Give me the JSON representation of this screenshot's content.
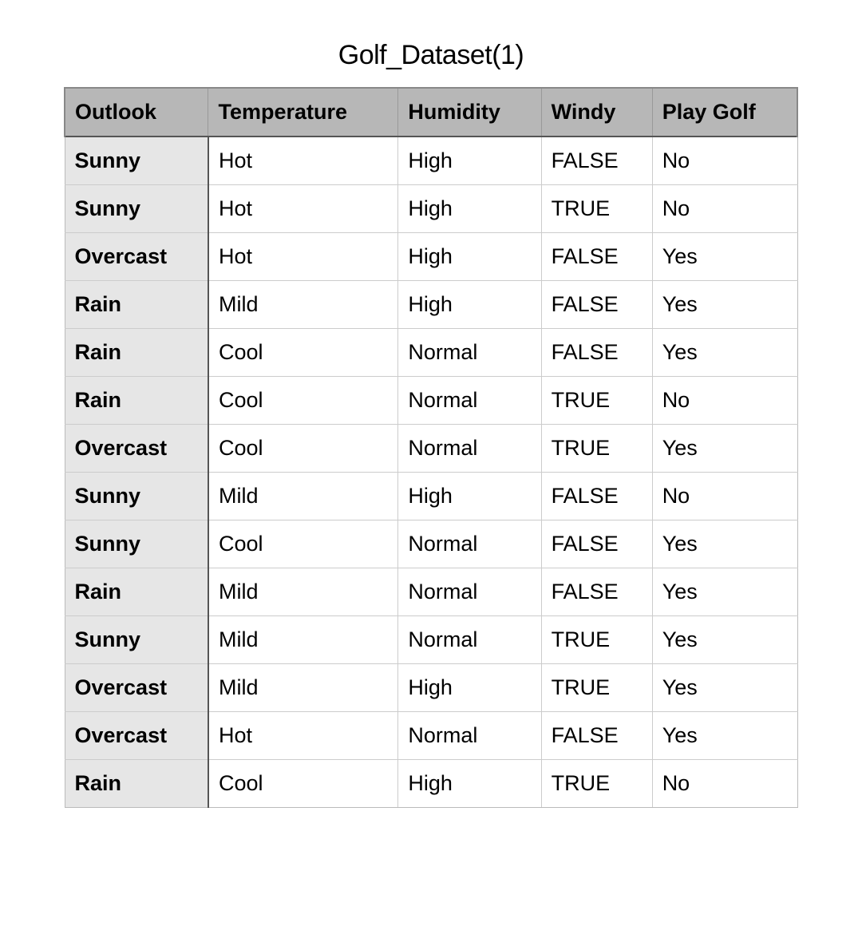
{
  "title": "Golf_Dataset(1)",
  "columns": [
    "Outlook",
    "Temperature",
    "Humidity",
    "Windy",
    "Play Golf"
  ],
  "rows": [
    {
      "outlook": "Sunny",
      "temperature": "Hot",
      "humidity": "High",
      "windy": "FALSE",
      "play": "No"
    },
    {
      "outlook": "Sunny",
      "temperature": "Hot",
      "humidity": "High",
      "windy": "TRUE",
      "play": "No"
    },
    {
      "outlook": "Overcast",
      "temperature": "Hot",
      "humidity": "High",
      "windy": "FALSE",
      "play": "Yes"
    },
    {
      "outlook": "Rain",
      "temperature": "Mild",
      "humidity": "High",
      "windy": "FALSE",
      "play": "Yes"
    },
    {
      "outlook": "Rain",
      "temperature": "Cool",
      "humidity": "Normal",
      "windy": "FALSE",
      "play": "Yes"
    },
    {
      "outlook": "Rain",
      "temperature": "Cool",
      "humidity": "Normal",
      "windy": "TRUE",
      "play": "No"
    },
    {
      "outlook": "Overcast",
      "temperature": "Cool",
      "humidity": "Normal",
      "windy": "TRUE",
      "play": "Yes"
    },
    {
      "outlook": "Sunny",
      "temperature": "Mild",
      "humidity": "High",
      "windy": "FALSE",
      "play": "No"
    },
    {
      "outlook": "Sunny",
      "temperature": "Cool",
      "humidity": "Normal",
      "windy": "FALSE",
      "play": "Yes"
    },
    {
      "outlook": "Rain",
      "temperature": "Mild",
      "humidity": "Normal",
      "windy": "FALSE",
      "play": "Yes"
    },
    {
      "outlook": "Sunny",
      "temperature": "Mild",
      "humidity": "Normal",
      "windy": "TRUE",
      "play": "Yes"
    },
    {
      "outlook": "Overcast",
      "temperature": "Mild",
      "humidity": "High",
      "windy": "TRUE",
      "play": "Yes"
    },
    {
      "outlook": "Overcast",
      "temperature": "Hot",
      "humidity": "Normal",
      "windy": "FALSE",
      "play": "Yes"
    },
    {
      "outlook": "Rain",
      "temperature": "Cool",
      "humidity": "High",
      "windy": "TRUE",
      "play": "No"
    }
  ],
  "chart_data": {
    "type": "table",
    "title": "Golf_Dataset(1)",
    "columns": [
      "Outlook",
      "Temperature",
      "Humidity",
      "Windy",
      "Play Golf"
    ],
    "data": [
      [
        "Sunny",
        "Hot",
        "High",
        "FALSE",
        "No"
      ],
      [
        "Sunny",
        "Hot",
        "High",
        "TRUE",
        "No"
      ],
      [
        "Overcast",
        "Hot",
        "High",
        "FALSE",
        "Yes"
      ],
      [
        "Rain",
        "Mild",
        "High",
        "FALSE",
        "Yes"
      ],
      [
        "Rain",
        "Cool",
        "Normal",
        "FALSE",
        "Yes"
      ],
      [
        "Rain",
        "Cool",
        "Normal",
        "TRUE",
        "No"
      ],
      [
        "Overcast",
        "Cool",
        "Normal",
        "TRUE",
        "Yes"
      ],
      [
        "Sunny",
        "Mild",
        "High",
        "FALSE",
        "No"
      ],
      [
        "Sunny",
        "Cool",
        "Normal",
        "FALSE",
        "Yes"
      ],
      [
        "Rain",
        "Mild",
        "Normal",
        "FALSE",
        "Yes"
      ],
      [
        "Sunny",
        "Mild",
        "Normal",
        "TRUE",
        "Yes"
      ],
      [
        "Overcast",
        "Mild",
        "High",
        "TRUE",
        "Yes"
      ],
      [
        "Overcast",
        "Hot",
        "Normal",
        "FALSE",
        "Yes"
      ],
      [
        "Rain",
        "Cool",
        "High",
        "TRUE",
        "No"
      ]
    ]
  }
}
